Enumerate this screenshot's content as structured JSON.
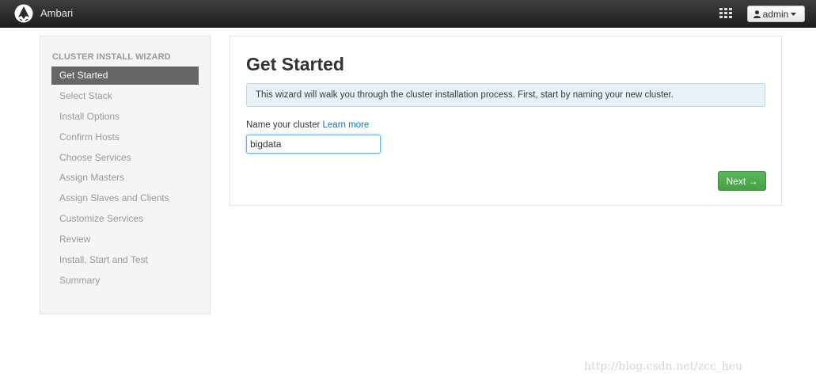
{
  "topbar": {
    "app_title": "Ambari",
    "user_label": "admin",
    "icons": [
      "ambari-logo-icon",
      "apps-grid-icon",
      "user-icon",
      "caret-down-icon"
    ]
  },
  "sidebar": {
    "header": "CLUSTER INSTALL WIZARD",
    "items": [
      {
        "label": "Get Started",
        "active": true
      },
      {
        "label": "Select Stack",
        "active": false
      },
      {
        "label": "Install Options",
        "active": false
      },
      {
        "label": "Confirm Hosts",
        "active": false
      },
      {
        "label": "Choose Services",
        "active": false
      },
      {
        "label": "Assign Masters",
        "active": false
      },
      {
        "label": "Assign Slaves and Clients",
        "active": false
      },
      {
        "label": "Customize Services",
        "active": false
      },
      {
        "label": "Review",
        "active": false
      },
      {
        "label": "Install, Start and Test",
        "active": false
      },
      {
        "label": "Summary",
        "active": false
      }
    ]
  },
  "main": {
    "title": "Get Started",
    "alert": "This wizard will walk you through the cluster installation process. First, start by naming your new cluster.",
    "field_label": "Name your cluster",
    "learn_more": "Learn more",
    "cluster_name_value": "bigdata",
    "next_label": "Next →"
  },
  "watermark": "http://blog.csdn.net/zcc_heu",
  "colors": {
    "topbar": "#2b2b2b",
    "active_nav": "#666666",
    "next_button": "#4cae4c",
    "link": "#0a74c8",
    "alert_bg": "#e8f1f8"
  }
}
